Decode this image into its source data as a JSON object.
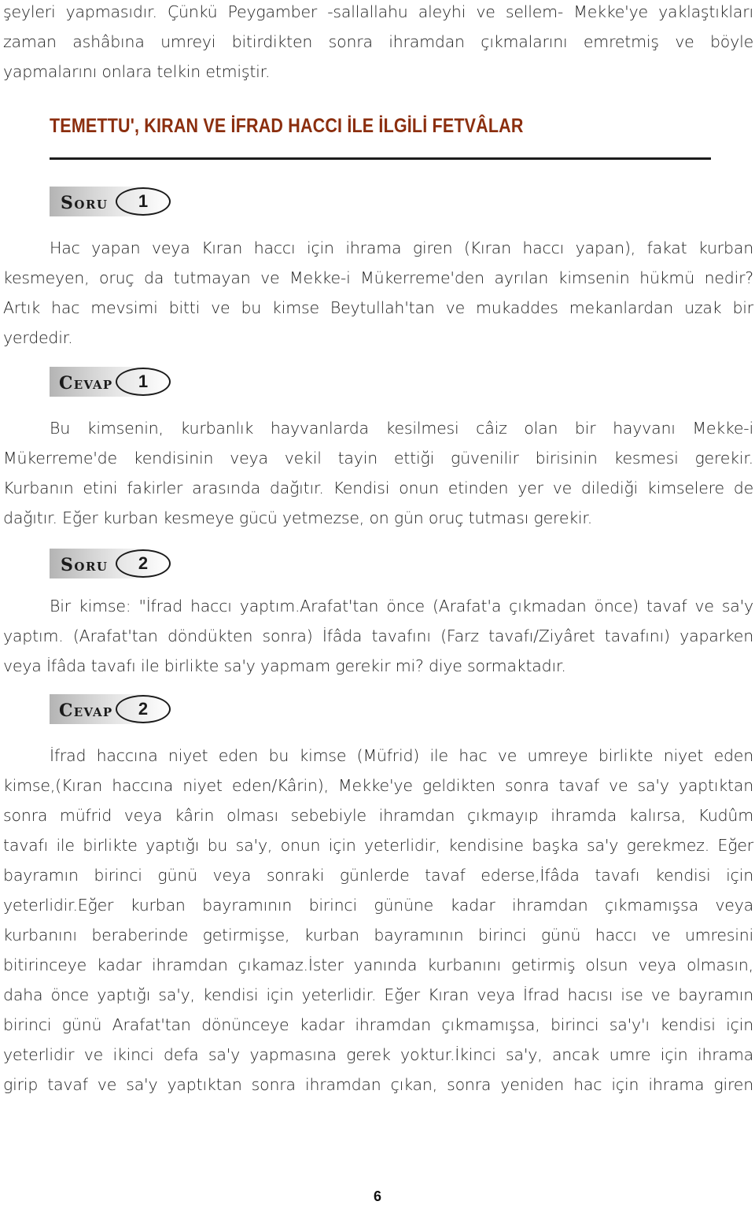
{
  "colors": {
    "title": "#8b2e0e",
    "text": "#222222",
    "divider": "#1c1c1c",
    "badge_gradient_dark": "#b4b4b4",
    "badge_gradient_light": "#ffffff"
  },
  "intro": {
    "lines": [
      "şeyleri yapmasıdır. Çünkü Peygamber -sallallahu aleyhi ve sellem- Mekke'ye yaklaştıkları",
      "zaman ashâbına umreyi bitirdikten sonra ihramdan çıkmalarını emretmiş ve böyle",
      "yapmalarını onlara telkin etmiştir."
    ]
  },
  "section": {
    "title": "TEMETTU', KIRAN VE İFRAD HACCI İLE İLGİLİ FETVÂLAR"
  },
  "qa": [
    {
      "question_badge": {
        "label_first": "S",
        "label_rest": "ORU",
        "number": "1"
      },
      "question_lines": [
        "Hac yapan veya Kıran haccı için ihrama giren (Kıran haccı yapan), fakat kurban",
        "kesmeyen, oruç da tutmayan ve Mekke-i Mükerreme'den ayrılan kimsenin hükmü nedir?",
        "Artık hac mevsimi bitti ve bu kimse Beytullah'tan ve mukaddes mekanlardan uzak bir",
        "yerdedir."
      ],
      "answer_badge": {
        "label_first": "C",
        "label_rest": "EVAP",
        "number": "1"
      },
      "answer_lines": [
        "Bu kimsenin, kurbanlık hayvanlarda kesilmesi câiz olan bir hayvanı Mekke-i",
        "Mükerreme'de kendisinin veya vekil tayin ettiği güvenilir birisinin kesmesi gerekir.",
        "Kurbanın etini fakirler arasında dağıtır. Kendisi onun etinden yer ve dilediği kimselere de",
        "dağıtır. Eğer kurban kesmeye gücü yetmezse, on gün oruç tutması gerekir."
      ]
    },
    {
      "question_badge": {
        "label_first": "S",
        "label_rest": "ORU",
        "number": "2"
      },
      "question_lines": [
        "Bir kimse: \"İfrad haccı yaptım.Arafat'tan önce (Arafat'a çıkmadan önce) tavaf ve sa'y",
        "yaptım. (Arafat'tan döndükten sonra) İfâda tavafını (Farz tavafı/Ziyâret tavafını) yaparken",
        "veya İfâda tavafı ile birlikte sa'y yapmam gerekir mi? diye sormaktadır."
      ],
      "answer_badge": {
        "label_first": "C",
        "label_rest": "EVAP",
        "number": "2"
      },
      "answer_lines": [
        "İfrad haccına niyet eden bu kimse (Müfrid) ile hac ve umreye birlikte niyet eden",
        "kimse,(Kıran haccına niyet eden/Kârin), Mekke'ye geldikten sonra tavaf ve sa'y yaptıktan",
        "sonra müfrid veya kârin olması sebebiyle ihramdan çıkmayıp ihramda kalırsa, Kudûm",
        "tavafı ile birlikte yaptığı bu sa'y, onun için yeterlidir, kendisine başka sa'y gerekmez. Eğer",
        "bayramın birinci günü veya sonraki günlerde tavaf ederse,İfâda tavafı kendisi için",
        "yeterlidir.Eğer kurban bayramının birinci gününe kadar ihramdan çıkmamışsa veya",
        "kurbanını beraberinde getirmişse, kurban bayramının birinci günü haccı ve umresini",
        "bitirinceye kadar ihramdan çıkamaz.İster yanında kurbanını getirmiş olsun veya olmasın,",
        "daha önce yaptığı sa'y, kendisi için yeterlidir. Eğer Kıran veya İfrad hacısı ise ve bayramın",
        "birinci günü Arafat'tan dönünceye kadar ihramdan çıkmamışsa, birinci sa'y'ı kendisi için",
        "yeterlidir ve ikinci defa sa'y yapmasına gerek yoktur.İkinci sa'y, ancak umre için ihrama",
        "girip tavaf ve sa'y yaptıktan sonra ihramdan çıkan, sonra yeniden hac için ihrama giren"
      ]
    }
  ],
  "footer": {
    "page_number": "6"
  }
}
